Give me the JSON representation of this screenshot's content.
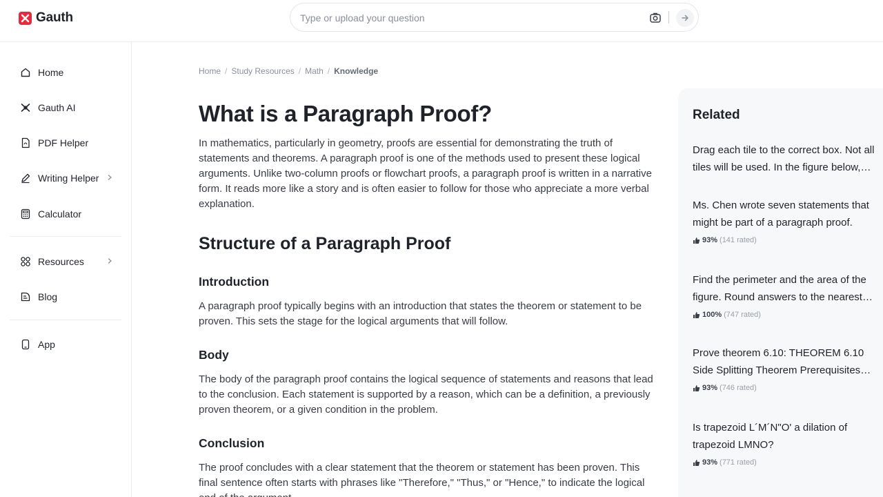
{
  "header": {
    "brand": "Gauth",
    "search_placeholder": "Type or upload your question"
  },
  "sidebar": {
    "items": [
      {
        "label": "Home",
        "icon": "home-icon"
      },
      {
        "label": "Gauth AI",
        "icon": "gauth-ai-icon"
      },
      {
        "label": "PDF Helper",
        "icon": "pdf-icon"
      },
      {
        "label": "Writing Helper",
        "icon": "pen-icon",
        "has_submenu": true
      },
      {
        "label": "Calculator",
        "icon": "calculator-icon"
      },
      {
        "label": "Resources",
        "icon": "grid-icon",
        "has_submenu": true
      },
      {
        "label": "Blog",
        "icon": "blog-icon"
      },
      {
        "label": "App",
        "icon": "phone-icon"
      }
    ]
  },
  "breadcrumb": [
    "Home",
    "Study Resources",
    "Math",
    "Knowledge"
  ],
  "article": {
    "title": "What is a Paragraph Proof?",
    "intro": "In mathematics, particularly in geometry, proofs are essential for demonstrating the truth of statements and theorems. A paragraph proof is one of the methods used to present these logical arguments. Unlike two-column proofs or flowchart proofs, a paragraph proof is written in a narrative form. It reads more like a story and is often easier to follow for those who appreciate a more verbal explanation.",
    "section_title": "Structure of a Paragraph Proof",
    "sections": [
      {
        "heading": "Introduction",
        "text": "A paragraph proof typically begins with an introduction that states the theorem or statement to be proven. This sets the stage for the logical arguments that will follow."
      },
      {
        "heading": "Body",
        "text": "The body of the paragraph proof contains the logical sequence of statements and reasons that lead to the conclusion. Each statement is supported by a reason, which can be a definition, a previously proven theorem, or a given condition in the problem."
      },
      {
        "heading": "Conclusion",
        "text": "The proof concludes with a clear statement that the theorem or statement has been proven. This final sentence often starts with phrases like \"Therefore,\" \"Thus,\" or \"Hence,\" to indicate the logical end of the argument."
      }
    ]
  },
  "related": {
    "title": "Related",
    "items": [
      {
        "question": "Drag each tile to the correct box. Not all tiles will be used. In the figure below, ABCD is a parallelogram.",
        "percent": "",
        "count": ""
      },
      {
        "question": "Ms. Chen wrote seven statements that might be part of a paragraph proof.",
        "percent": "93%",
        "count": "(141 rated)"
      },
      {
        "question": "Find the perimeter and the area of the figure. Round answers to the nearest tenth.",
        "percent": "100%",
        "count": "(747 rated)"
      },
      {
        "question": "Prove theorem 6.10: THEOREM 6.10 Side Splitting Theorem Prerequisites and proof.",
        "percent": "93%",
        "count": "(746 rated)"
      },
      {
        "question": "Is trapezoid L´M´N\"O' a dilation of trapezoid LMNO?",
        "percent": "93%",
        "count": "(771 rated)"
      }
    ]
  },
  "colors": {
    "brand": "#e8283b",
    "panel": "#f7f8fa"
  }
}
